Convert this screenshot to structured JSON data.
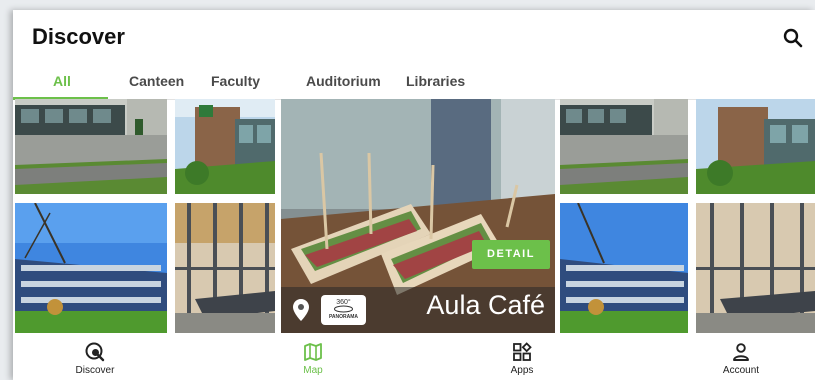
{
  "header": {
    "title": "Discover"
  },
  "tabs": [
    {
      "label": "All",
      "active": true
    },
    {
      "label": "Canteen",
      "active": false
    },
    {
      "label": "Faculty",
      "active": false
    },
    {
      "label": "Auditorium",
      "active": false
    },
    {
      "label": "Libraries",
      "active": false
    }
  ],
  "featured": {
    "name": "Aula Café",
    "detail_label": "DETAIL",
    "panorama_label": "PANORAMA",
    "panorama_badge": "360°"
  },
  "bottom_nav": [
    {
      "label": "Discover",
      "icon": "explore-icon",
      "active": false
    },
    {
      "label": "Map",
      "icon": "map-icon",
      "active": true
    },
    {
      "label": "Apps",
      "icon": "apps-icon",
      "active": false
    },
    {
      "label": "Account",
      "icon": "account-icon",
      "active": false
    }
  ],
  "colors": {
    "accent": "#6cc04a",
    "text": "#111111",
    "tab_inactive": "#4a4a4a"
  }
}
